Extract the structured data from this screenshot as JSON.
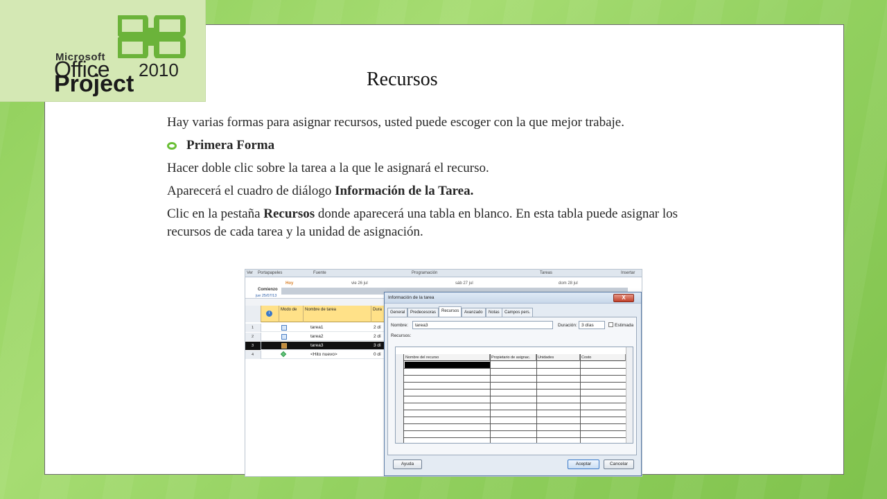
{
  "logo": {
    "brand": "Microsoft",
    "product": "Office",
    "year": "2010",
    "app": "Project"
  },
  "slide": {
    "title": "Recursos",
    "intro": "Hay varias formas para asignar recursos, usted puede escoger con la que mejor trabaje.",
    "bullet": "Primera Forma",
    "line1": "Hacer doble clic sobre la tarea a la que le asignará el recurso.",
    "line2_pre": "Aparecerá el cuadro de diálogo ",
    "line2_bold": "Información de la Tarea.",
    "line3_pre": "Clic en la pestaña ",
    "line3_bold": "Recursos",
    "line3_post": " donde aparecerá una tabla en blanco. En esta tabla puede asignar los recursos de cada tarea y la unidad de asignación.",
    "accent_color": "#6abf36"
  },
  "screenshot": {
    "ribbon_groups": [
      "Ver",
      "Portapapeles",
      "Fuente",
      "Programación",
      "Tareas",
      "Insertar"
    ],
    "timeline": {
      "today": "Hoy",
      "dates": [
        "vie 26 jul",
        "sáb 27 jul",
        "dom 28 jul"
      ],
      "start_label": "Comienzo",
      "start_date": "jue 25/07/13"
    },
    "grid_headers": [
      "Modo de",
      "Nombre de tarea",
      "Dura"
    ],
    "tasks": [
      {
        "num": "1",
        "name": "tarea1",
        "dur": "2 dí"
      },
      {
        "num": "2",
        "name": "tarea2",
        "dur": "2 dí"
      },
      {
        "num": "3",
        "name": "tarea3",
        "dur": "3 dí"
      },
      {
        "num": "4",
        "name": "<Hito nuevo>",
        "dur": "0 dí"
      }
    ],
    "dialog": {
      "title": "Información de la tarea",
      "close": "X",
      "tabs": [
        "General",
        "Predecesoras",
        "Recursos",
        "Avanzado",
        "Notas",
        "Campos pers."
      ],
      "active_tab": "Recursos",
      "name_label": "Nombre:",
      "name_value": "tarea3",
      "duration_label": "Duración:",
      "duration_value": "3 días",
      "estimated_label": "Estimada",
      "resources_label": "Recursos:",
      "columns": [
        "Nombre del recurso",
        "Propietario de asignac.",
        "Unidades",
        "Costo"
      ],
      "help_button": "Ayuda",
      "ok_button": "Aceptar",
      "cancel_button": "Cancelar"
    }
  }
}
